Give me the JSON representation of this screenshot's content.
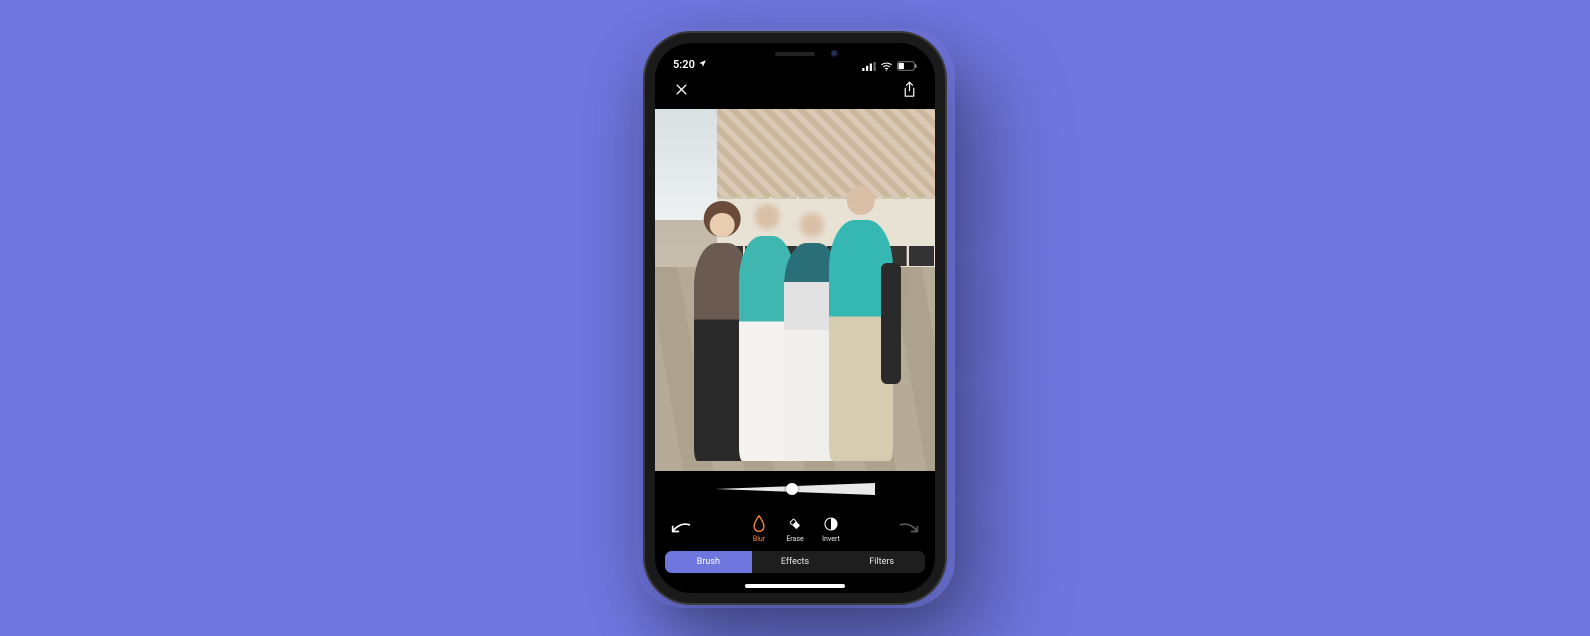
{
  "status_bar": {
    "time": "5:20",
    "location_icon": "location-arrow",
    "signal": 4,
    "wifi": true,
    "battery": 35
  },
  "header": {
    "close_label": "Close",
    "share_label": "Share"
  },
  "photo": {
    "description": "Four people posing in a plaza in front of an ornate historic building with pointed arches; three faces are blurred."
  },
  "slider": {
    "value": 0.5,
    "label": "Blur intensity"
  },
  "tools": {
    "undo": "Undo",
    "redo": "Redo",
    "items": [
      {
        "key": "blur",
        "label": "Blur",
        "active": true
      },
      {
        "key": "erase",
        "label": "Erase",
        "active": false
      },
      {
        "key": "invert",
        "label": "Invert",
        "active": false
      }
    ]
  },
  "tabs": [
    {
      "key": "brush",
      "label": "Brush",
      "active": true
    },
    {
      "key": "effects",
      "label": "Effects",
      "active": false
    },
    {
      "key": "filters",
      "label": "Filters",
      "active": false
    }
  ],
  "colors": {
    "background": "#6f76de",
    "accent": "#ff8a3c"
  }
}
